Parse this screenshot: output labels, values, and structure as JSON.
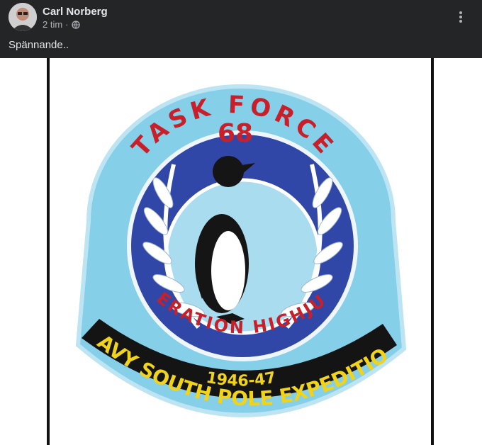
{
  "post": {
    "author": "Carl Norberg",
    "time": "2 tim",
    "separator": "·",
    "visibility_icon": "globe-icon",
    "menu_icon": "more-options-icon",
    "text": "Spännande.."
  },
  "patch": {
    "top_text": "TASK FORCE",
    "number": "68",
    "mid_text": "OPERATION HIGHJUMP",
    "years": "1946-47",
    "bottom_text": "NAVY SOUTH POLE EXPEDITION",
    "colors": {
      "light_blue": "#86cfe8",
      "dark_blue": "#3147a8",
      "red": "#c8202a",
      "yellow": "#f1d31a",
      "black": "#141414"
    }
  }
}
